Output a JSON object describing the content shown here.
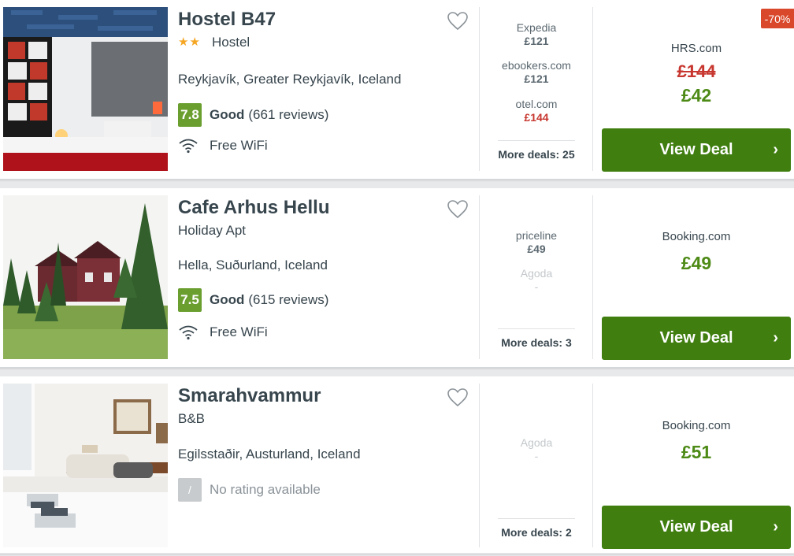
{
  "colors": {
    "accent_green": "#3f7e0f",
    "score_green": "#6a9e2f",
    "price_green": "#4d8a16",
    "strike_red": "#c7372f",
    "badge_red": "#d9482b",
    "star_gold": "#f5a623"
  },
  "icons": {
    "favorite": "heart-outline-icon",
    "wifi": "wifi-icon",
    "button_arrow": "chevron-right-icon",
    "stars": "star-icon"
  },
  "hotels": [
    {
      "name": "Hostel B47",
      "stars": "★★",
      "type": "Hostel",
      "location": "Reykjavík, Greater Reykjavík, Iceland",
      "score": "7.8",
      "rating_word": "Good",
      "rating_count": "(661 reviews)",
      "amenity": "Free WiFi",
      "deals": [
        {
          "site": "Expedia",
          "price": "£121"
        },
        {
          "site": "ebookers.com",
          "price": "£121"
        },
        {
          "site": "otel.com",
          "price": "£144"
        }
      ],
      "more_deals": "More deals: 25",
      "best_partner": "HRS.com",
      "old_price": "£144",
      "price": "£42",
      "badge": "-70%",
      "button": "View Deal",
      "button_arrow": "›"
    },
    {
      "name": "Cafe Arhus Hellu",
      "type": "Holiday Apt",
      "location": "Hella, Suðurland, Iceland",
      "score": "7.5",
      "rating_word": "Good",
      "rating_count": "(615 reviews)",
      "amenity": "Free WiFi",
      "deals": [
        {
          "site": "priceline",
          "price": "£49"
        },
        {
          "site": "Agoda",
          "price": "-"
        }
      ],
      "more_deals": "More deals: 3",
      "best_partner": "Booking.com",
      "price": "£49",
      "button": "View Deal",
      "button_arrow": "›"
    },
    {
      "name": "Smarahvammur",
      "type": "B&B",
      "location": "Egilsstaðir, Austurland, Iceland",
      "score": "/",
      "rating_none": "No rating available",
      "deals": [
        {
          "site": "Agoda",
          "price": "-"
        }
      ],
      "more_deals": "More deals: 2",
      "best_partner": "Booking.com",
      "price": "£51",
      "button": "View Deal",
      "button_arrow": "›"
    }
  ]
}
